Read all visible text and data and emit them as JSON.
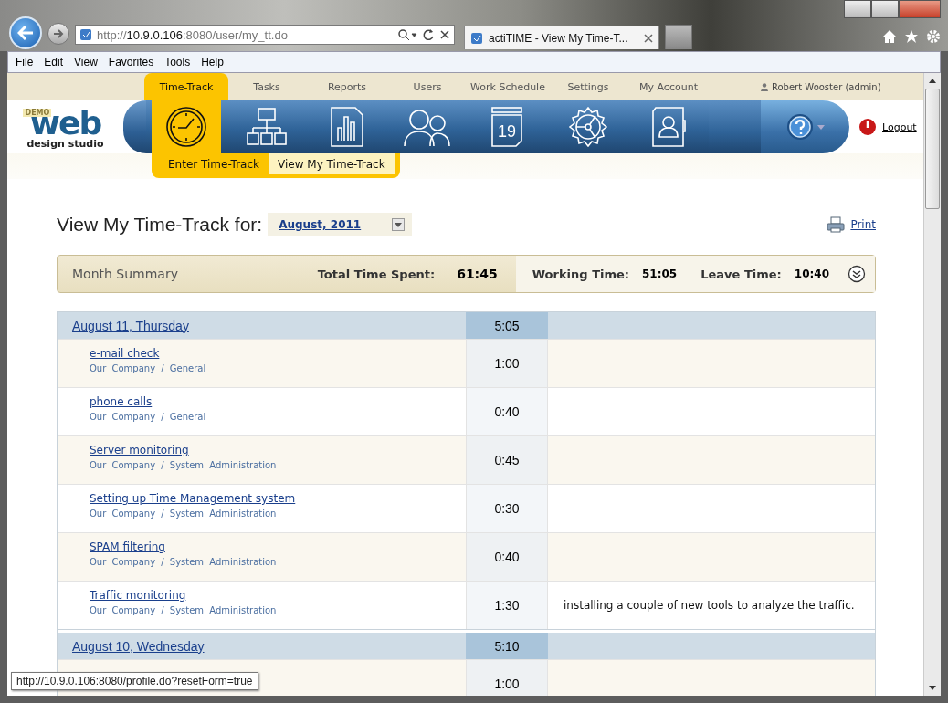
{
  "browser": {
    "address": "http://**10.9.0.106**:8080/user/my_tt.do",
    "tab_title": "actiTIME - View My Time-T...",
    "menu": [
      "File",
      "Edit",
      "View",
      "Favorites",
      "Tools",
      "Help"
    ],
    "status_tooltip": "http://10.9.0.106:8080/profile.do?resetForm=true"
  },
  "logo": {
    "badge": "DEMO",
    "word": "web",
    "subtitle": "design studio"
  },
  "nav": [
    {
      "label": "Time-Track",
      "kind": "clock",
      "selected": true
    },
    {
      "label": "Tasks",
      "kind": "hierarchy",
      "selected": false
    },
    {
      "label": "Reports",
      "kind": "chart",
      "selected": false
    },
    {
      "label": "Users",
      "kind": "people",
      "selected": false
    },
    {
      "label": "Work Schedule",
      "kind": "calendar",
      "icon_text": "19",
      "selected": false
    },
    {
      "label": "Settings",
      "kind": "gear",
      "selected": false
    },
    {
      "label": "My Account",
      "kind": "contact",
      "selected": false
    }
  ],
  "user": "Robert Wooster (admin)",
  "logout": "Logout",
  "subtabs": [
    {
      "label": "Enter Time-Track",
      "selected": false
    },
    {
      "label": "View My Time-Track",
      "selected": true
    }
  ],
  "page_title": "View My Time-Track for:",
  "period": "August, 2011",
  "print": "Print",
  "summary": {
    "title": "Month Summary",
    "total_label": "Total Time Spent:",
    "total": "61:45",
    "working_label": "Working Time:",
    "working": "51:05",
    "leave_label": "Leave Time:",
    "leave": "10:40"
  },
  "days": [
    {
      "date": "August 11, Thursday",
      "total": "5:05",
      "rows": [
        {
          "task": "e-mail check",
          "customer_project": "Our Company / General",
          "time": "1:00"
        },
        {
          "task": "phone calls",
          "customer_project": "Our Company / General",
          "time": "0:40"
        },
        {
          "task": "Server monitoring",
          "customer_project": "Our Company / System Administration",
          "time": "0:45"
        },
        {
          "task": "Setting up Time Management system",
          "customer_project": "Our Company / System Administration",
          "time": "0:30"
        },
        {
          "task": "SPAM filtering",
          "customer_project": "Our Company / System Administration",
          "time": "0:40"
        },
        {
          "task": "Traffic monitoring",
          "customer_project": "Our Company / System Administration",
          "time": "1:30",
          "comment": "installing a couple of new tools to analyze the traffic."
        }
      ]
    },
    {
      "date": "August 10, Wednesday",
      "total": "5:10",
      "rows": [
        {
          "time": "1:00"
        }
      ]
    }
  ]
}
